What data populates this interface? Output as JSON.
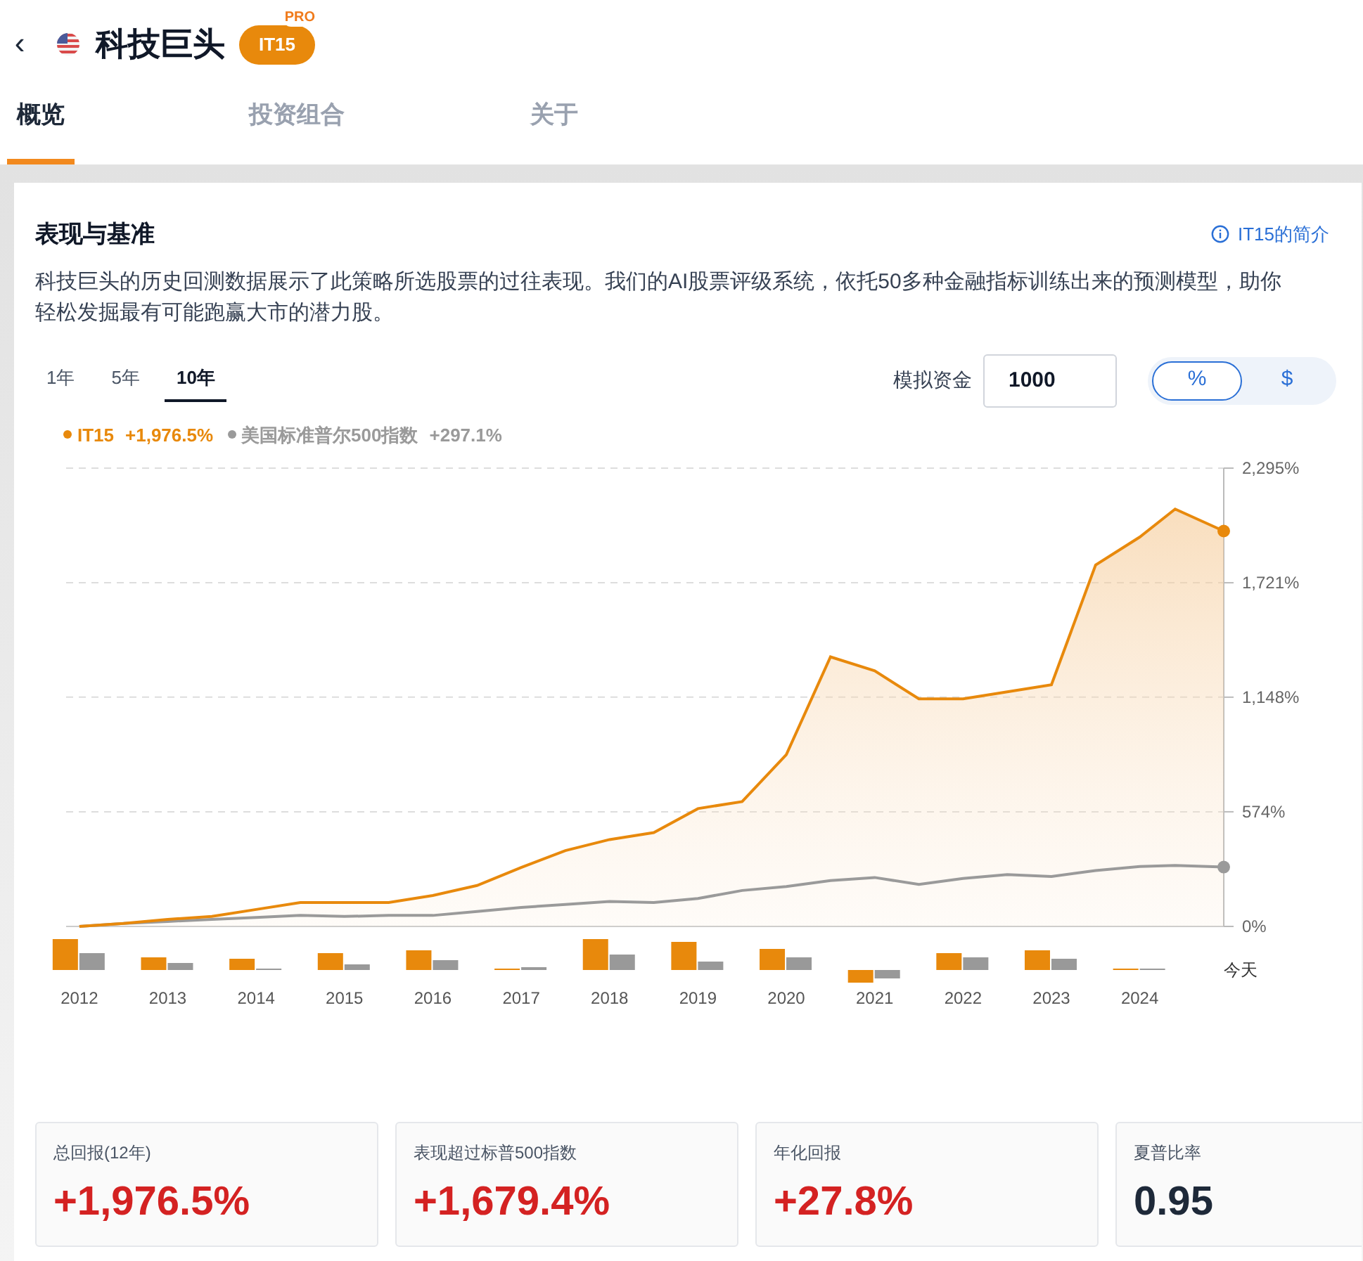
{
  "header": {
    "back": "‹",
    "title": "科技巨头",
    "badge": "IT15",
    "badge_tag": "PRO"
  },
  "tabs": [
    {
      "label": "概览",
      "selected": true
    },
    {
      "label": "投资组合",
      "selected": false
    },
    {
      "label": "关于",
      "selected": false
    }
  ],
  "performance": {
    "title": "表现与基准",
    "info_link": "IT15的简介",
    "description": "科技巨头的历史回测数据展示了此策略所选股票的过往表现。我们的AI股票评级系统，依托50多种金融指标训练出来的预测模型，助你轻松发掘最有可能跑赢大市的潜力股。",
    "periods": [
      {
        "label": "1年",
        "selected": false
      },
      {
        "label": "5年",
        "selected": false
      },
      {
        "label": "10年",
        "selected": true
      }
    ],
    "capital_label": "模拟资金",
    "capital_value": "1000",
    "units": [
      {
        "label": "%",
        "selected": true
      },
      {
        "label": "$",
        "selected": false
      }
    ],
    "legend_values": [
      "+1,976.5%",
      "+297.1%"
    ],
    "chart_data": {
      "type": "line",
      "x": [
        2012,
        2012.5,
        2013,
        2013.5,
        2014,
        2014.5,
        2015,
        2015.5,
        2016,
        2016.5,
        2017,
        2017.5,
        2018,
        2018.5,
        2019,
        2019.5,
        2020,
        2020.5,
        2021,
        2021.5,
        2022,
        2022.5,
        2023,
        2023.5,
        2024,
        2024.4,
        2024.95
      ],
      "series": [
        {
          "name": "IT15",
          "color": "#e8890c",
          "type": "area",
          "values": [
            0,
            15,
            35,
            50,
            85,
            120,
            120,
            120,
            155,
            205,
            295,
            380,
            435,
            470,
            590,
            625,
            860,
            1350,
            1280,
            1140,
            1140,
            1175,
            1210,
            1810,
            1950,
            2090,
            1980
          ]
        },
        {
          "name": "美国标准普尔500指数",
          "color": "#9a9a9a",
          "type": "line",
          "values": [
            0,
            15,
            25,
            35,
            45,
            55,
            50,
            55,
            55,
            75,
            95,
            110,
            125,
            120,
            140,
            180,
            200,
            230,
            245,
            210,
            240,
            260,
            250,
            280,
            300,
            305,
            297
          ]
        }
      ],
      "ylim": [
        0,
        2295
      ],
      "yticks": [
        {
          "value": 0,
          "label": "0%"
        },
        {
          "value": 574,
          "label": "574%"
        },
        {
          "value": 1148,
          "label": "1,148%"
        },
        {
          "value": 1721,
          "label": "1,721%"
        },
        {
          "value": 2295,
          "label": "2,295%"
        }
      ],
      "xlim": [
        2011.85,
        2024.95
      ],
      "xticks": [
        {
          "value": 2012,
          "label": "2012"
        },
        {
          "value": 2013,
          "label": "2013"
        },
        {
          "value": 2014,
          "label": "2014"
        },
        {
          "value": 2015,
          "label": "2015"
        },
        {
          "value": 2016,
          "label": "2016"
        },
        {
          "value": 2017,
          "label": "2017"
        },
        {
          "value": 2018,
          "label": "2018"
        },
        {
          "value": 2019,
          "label": "2019"
        },
        {
          "value": 2020,
          "label": "2020"
        },
        {
          "value": 2021,
          "label": "2021"
        },
        {
          "value": 2022,
          "label": "2022"
        },
        {
          "value": 2023,
          "label": "2023"
        },
        {
          "value": 2024,
          "label": "2024"
        }
      ],
      "grid": true
    },
    "today_label": "今天"
  },
  "stats": [
    {
      "label": "总回报(12年)",
      "value": "+1,976.5%",
      "kind": "positive"
    },
    {
      "label": "表现超过标普500指数",
      "value": "+1,679.4%",
      "kind": "positive"
    },
    {
      "label": "年化回报",
      "value": "+27.8%",
      "kind": "positive"
    },
    {
      "label": "夏普比率",
      "value": "0.95",
      "kind": "neutral"
    }
  ]
}
